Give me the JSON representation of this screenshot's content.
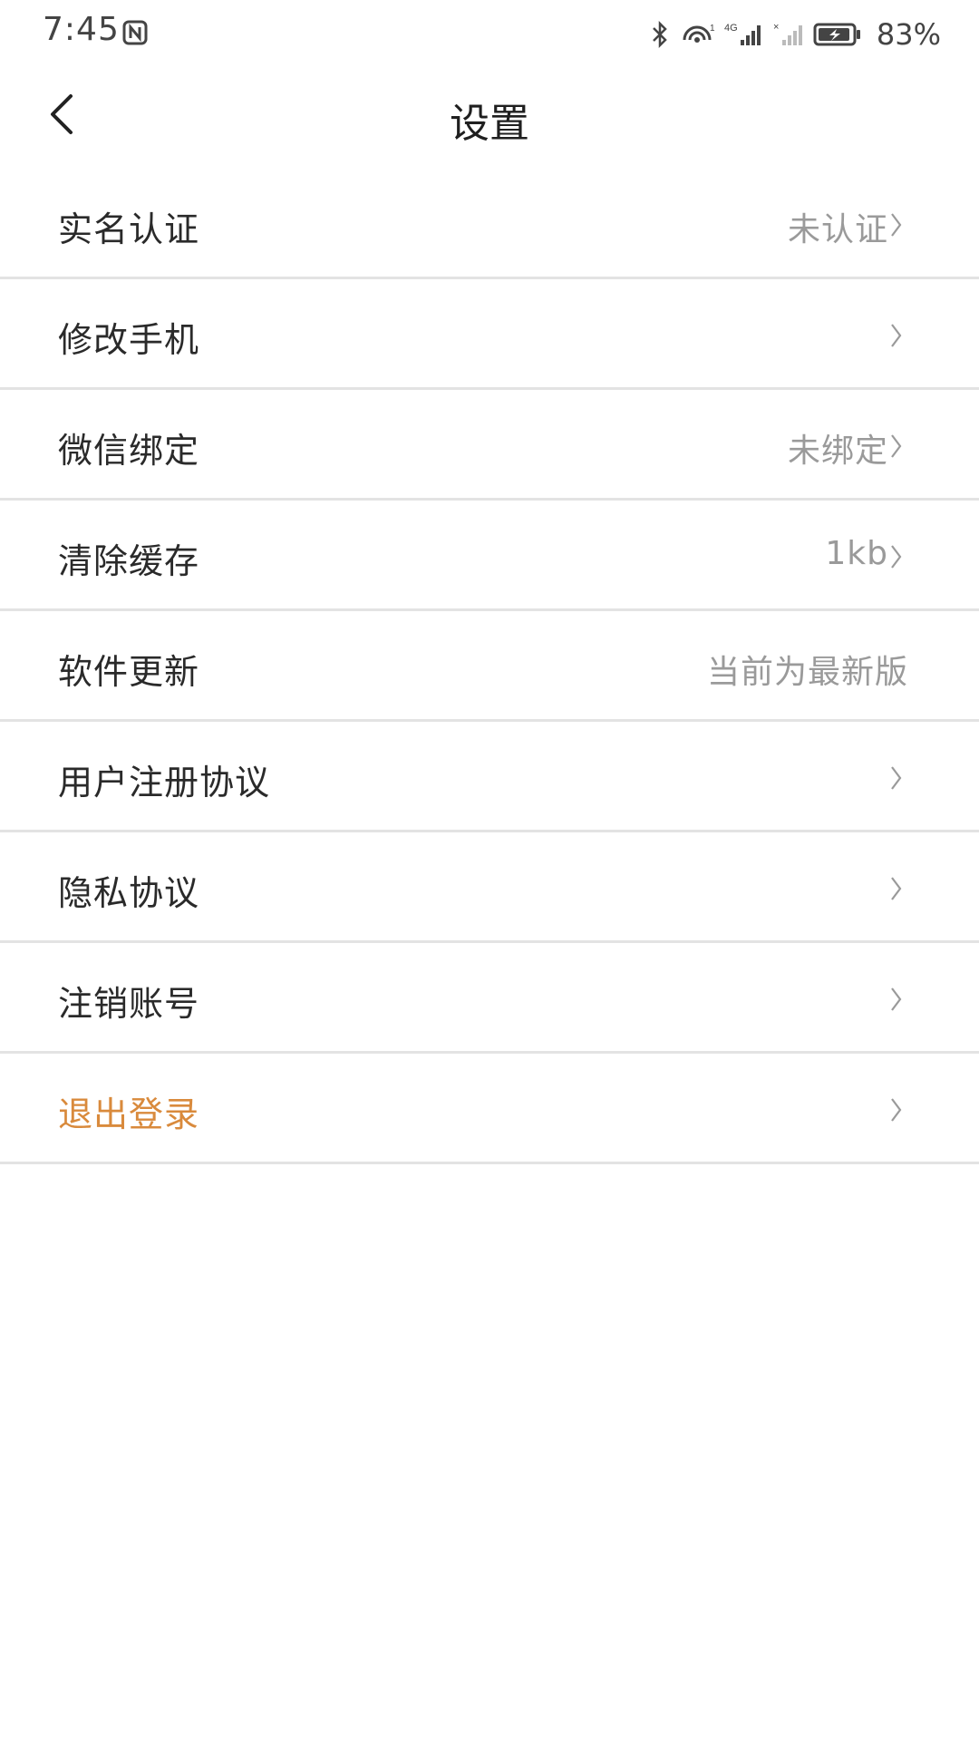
{
  "status_bar": {
    "time": "7:45",
    "battery_percent": "83%",
    "icons": [
      "nfc-icon",
      "bluetooth-icon",
      "hotspot-icon",
      "signal-4g-icon",
      "signal-noservice-icon",
      "battery-charging-icon"
    ],
    "signal_label": "4G"
  },
  "header": {
    "title": "设置",
    "back_icon": "chevron-left-icon"
  },
  "settings": [
    {
      "label": "实名认证",
      "value": "未认证",
      "chevron": true
    },
    {
      "label": "修改手机",
      "value": "",
      "chevron": true
    },
    {
      "label": "微信绑定",
      "value": "未绑定",
      "chevron": true
    },
    {
      "label": "清除缓存",
      "value": "1kb",
      "chevron": true
    },
    {
      "label": "软件更新",
      "value": "当前为最新版",
      "chevron": false
    },
    {
      "label": "用户注册协议",
      "value": "",
      "chevron": true
    },
    {
      "label": "隐私协议",
      "value": "",
      "chevron": true
    },
    {
      "label": "注销账号",
      "value": "",
      "chevron": true
    },
    {
      "label": "退出登录",
      "value": "",
      "chevron": true,
      "accent": true
    }
  ],
  "colors": {
    "accent": "#d98a3c",
    "text_primary": "#2a2a2a",
    "text_secondary": "#9a9a9a",
    "divider": "#e3e3e3"
  }
}
